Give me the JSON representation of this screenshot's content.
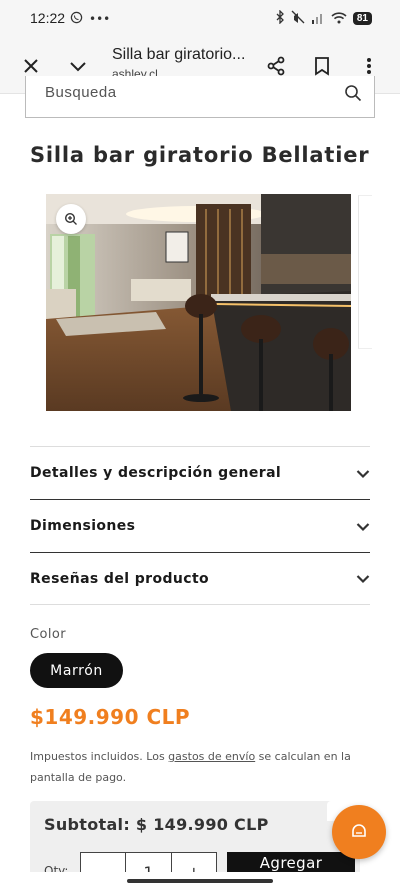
{
  "status_bar": {
    "time": "12:22",
    "battery": "81"
  },
  "browser": {
    "page_title": "Silla bar giratorio...",
    "domain": "ashley.cl"
  },
  "search": {
    "placeholder": "Busqueda"
  },
  "product": {
    "title": "Silla bar giratorio Bellatier",
    "image_alt": "Silla bar giratorio Bellatier en cocina"
  },
  "accordion": [
    {
      "label": "Detalles y descripción general"
    },
    {
      "label": "Dimensiones"
    },
    {
      "label": "Reseñas del producto"
    }
  ],
  "variant": {
    "label": "Color",
    "selected": "Marrón"
  },
  "price": "$149.990 CLP",
  "tax_note": {
    "part1": "Impuestos incluidos. Los ",
    "link": "gastos de envío",
    "part2": " se calculan en la pantalla de pago."
  },
  "cart": {
    "subtotal": "Subtotal: $ 149.990 CLP",
    "qty_label": "Qty:",
    "qty_value": "1",
    "minus": "−",
    "plus": "+",
    "add_label": "Agregar"
  },
  "colors": {
    "accent": "#f07f1f",
    "dark": "#111111"
  }
}
